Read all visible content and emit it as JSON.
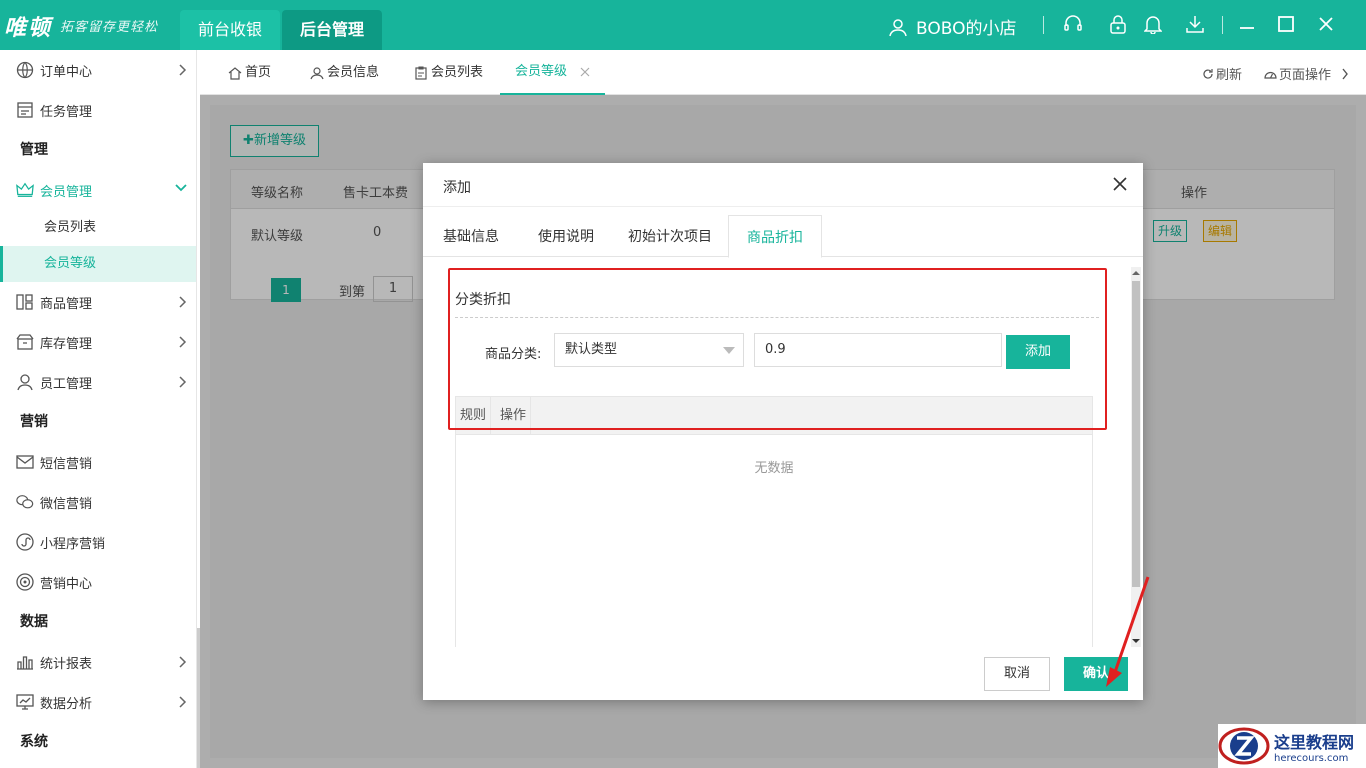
{
  "topbar": {
    "logo": "唯顿",
    "slogan": "拓客留存更轻松",
    "tabs": [
      {
        "label": "前台收银"
      },
      {
        "label": "后台管理"
      }
    ],
    "shop_name": "BOBO的小店",
    "accent": "#17b49b"
  },
  "sidebar": {
    "order_center": "订单中心",
    "task_manage": "任务管理",
    "group_manage": "管理",
    "member_manage": "会员管理",
    "member_list": "会员列表",
    "member_level": "会员等级",
    "goods_manage": "商品管理",
    "stock_manage": "库存管理",
    "staff_manage": "员工管理",
    "group_marketing": "营销",
    "sms": "短信营销",
    "wechat": "微信营销",
    "miniprogram": "小程序营销",
    "marketing_center": "营销中心",
    "group_data": "数据",
    "stats_report": "统计报表",
    "data_analysis": "数据分析",
    "group_system": "系统"
  },
  "pagetabs": {
    "home": "首页",
    "member_info": "会员信息",
    "member_list": "会员列表",
    "member_level": "会员等级",
    "refresh": "刷新",
    "page_ops": "页面操作"
  },
  "bg": {
    "new_level": "✚新增等级",
    "col_name": "等级名称",
    "col_card_fee": "售卡工本费",
    "col_ops": "操作",
    "row_name": "默认等级",
    "row_fee": "0",
    "upgrade": "升级",
    "edit": "编辑",
    "page": "1",
    "goto": "到第",
    "goto_val": "1"
  },
  "modal": {
    "title": "添加",
    "tabs": [
      "基础信息",
      "使用说明",
      "初始计次项目",
      "商品折扣"
    ],
    "section_title": "分类折扣",
    "category_label": "商品分类:",
    "category_value": "默认类型",
    "discount_value": "0.9",
    "add": "添加",
    "col_rule": "规则",
    "col_ops": "操作",
    "no_data": "无数据",
    "cancel": "取消",
    "confirm": "确认"
  },
  "watermark": {
    "cn": "这里教程网",
    "en": "herecours.com"
  }
}
